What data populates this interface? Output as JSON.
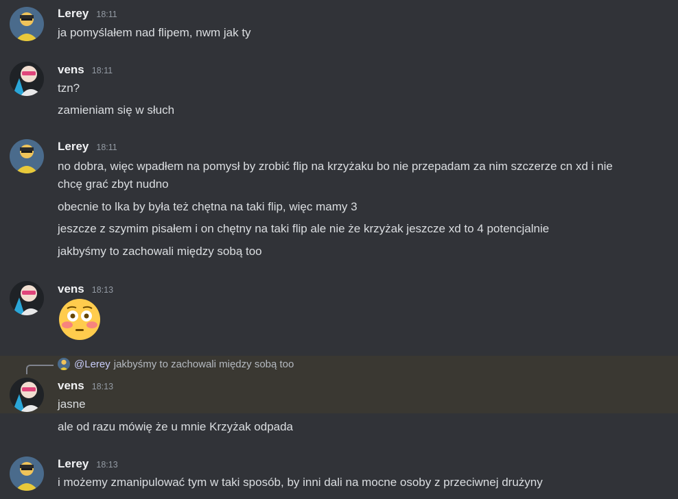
{
  "messages": [
    {
      "author": "Lerey",
      "time": "18:11",
      "lines": [
        "ja pomyślałem nad flipem, nwm jak ty"
      ]
    },
    {
      "author": "vens",
      "time": "18:11",
      "lines": [
        "tzn?",
        "zamieniam się w słuch"
      ]
    },
    {
      "author": "Lerey",
      "time": "18:11",
      "lines": [
        "no dobra, więc wpadłem na pomysł by zrobić flip na krzyżaku bo nie przepadam za nim szczerze cn xd i nie",
        "chcę grać zbyt nudno",
        "obecnie to lka by była też chętna na taki flip, więc mamy 3",
        "jeszcze z szymim pisałem i on chętny na taki flip ale nie że krzyżak jeszcze xd to 4 potencjalnie",
        "jakbyśmy to zachowali między sobą too"
      ]
    },
    {
      "author": "vens",
      "time": "18:13",
      "emoji": "flushed-face-emoji"
    },
    {
      "author": "vens",
      "time": "18:13",
      "reply": {
        "user": "@Lerey",
        "text": "jakbyśmy to zachowali między sobą too"
      },
      "lines": [
        "jasne",
        "ale od razu mówię że u mnie Krzyżak odpada"
      ]
    },
    {
      "author": "Lerey",
      "time": "18:13",
      "lines": [
        "i możemy zmanipulować tym w taki sposób, by inni dali na mocne osoby z przeciwnej drużyny"
      ]
    }
  ],
  "colors": {
    "background": "#313338",
    "text": "#dbdee1",
    "username": "#f2f3f5",
    "timestamp": "#949ba4",
    "reply_highlight": "#3a3832",
    "mention": "#c9cdfb"
  }
}
